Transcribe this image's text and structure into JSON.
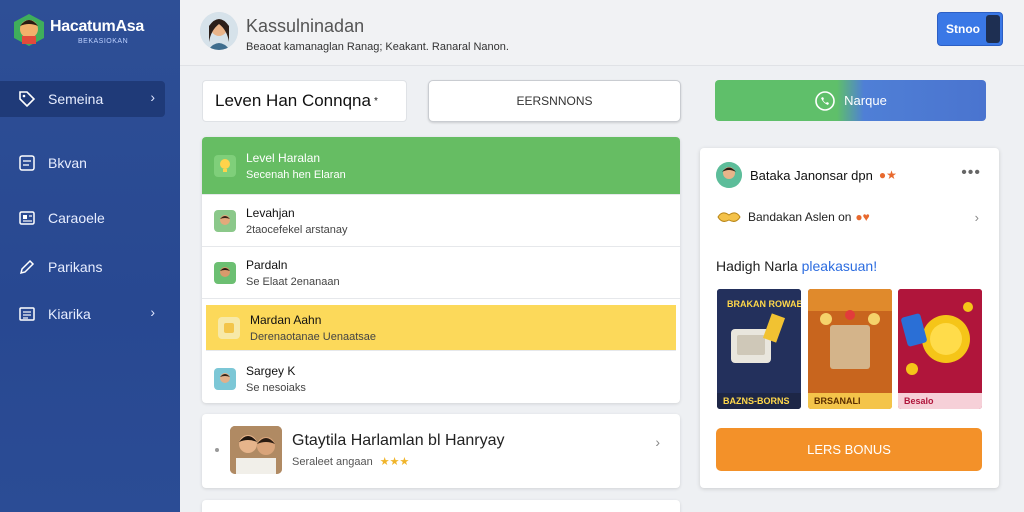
{
  "app": {
    "brand_name": "HacatumAsa",
    "brand_tagline": "BEKASIOKAN"
  },
  "sidebar": {
    "items": [
      {
        "label": "Semeina",
        "icon": "tag-icon",
        "active": true,
        "has_chevron": true
      },
      {
        "label": "Bkvan",
        "icon": "document-icon",
        "active": false,
        "has_chevron": false
      },
      {
        "label": "Caraoele",
        "icon": "image-icon",
        "active": false,
        "has_chevron": false
      },
      {
        "label": "Parikans",
        "icon": "pencil-icon",
        "active": false,
        "has_chevron": false
      },
      {
        "label": "Kiarika",
        "icon": "list-icon",
        "active": false,
        "has_chevron": true
      }
    ],
    "chevron": "›"
  },
  "header": {
    "title": "Kassulninadan",
    "subtitle": "Beaoat kamanaglan Ranag; Keakant. Ranaral Nanon.",
    "button_label": "Stnoo"
  },
  "toolbar": {
    "search_value": "Leven Han Connqna",
    "search_caret": "*",
    "outline_button": "EERSNNONS",
    "green_button": "Narque"
  },
  "list": {
    "rows": [
      {
        "title": "Level Haralan",
        "sub": "Secenah hen Elaran",
        "style": "green"
      },
      {
        "title": "Levahjan",
        "sub": "2taocefekel arstanay",
        "style": "plain"
      },
      {
        "title": "Pardaln",
        "sub": "Se Elaat 2enanaan",
        "style": "plain"
      },
      {
        "title": "Mardan Aahn",
        "sub": "Derenaotanae Uenaatsae",
        "style": "yellow"
      },
      {
        "title": "Sargey K",
        "sub": "Se nesoiaks",
        "style": "plain"
      }
    ]
  },
  "feature": {
    "title": "Gtaytila Harlamlan bl Hanryay",
    "sub": "Seraleet angaan",
    "stars": "★★★",
    "chevron": "›"
  },
  "right_panel": {
    "head_title": "Bataka Janonsar dpn",
    "head_badges": "●★",
    "more": "•••",
    "row2_text": "Bandakan Aslen on",
    "row2_badges": "●♥",
    "row2_chevron": "›",
    "heading_main": "Hadigh Narla ",
    "heading_highlight": "pleakasuan!",
    "promos": [
      {
        "top": "BRAKAN ROWAB",
        "label": "BAZNS-BORNS",
        "bg": "#23305c",
        "label_bg": "#1d2646",
        "label_color": "#ffd84a"
      },
      {
        "top": "",
        "label": "BRSANALI",
        "bg": "#c8651e",
        "label_bg": "#f4c44a",
        "label_color": "#5a2d00"
      },
      {
        "top": "",
        "label": "Besalo",
        "bg": "#b0153b",
        "label_bg": "#f6d0d8",
        "label_color": "#b0153b"
      }
    ],
    "cta_label": "LERS BONUS"
  },
  "colors": {
    "sidebar": "#2b4c95",
    "accent_blue": "#3a78e6",
    "green": "#66bd63",
    "yellow": "#fcd95a",
    "orange": "#f39129"
  }
}
